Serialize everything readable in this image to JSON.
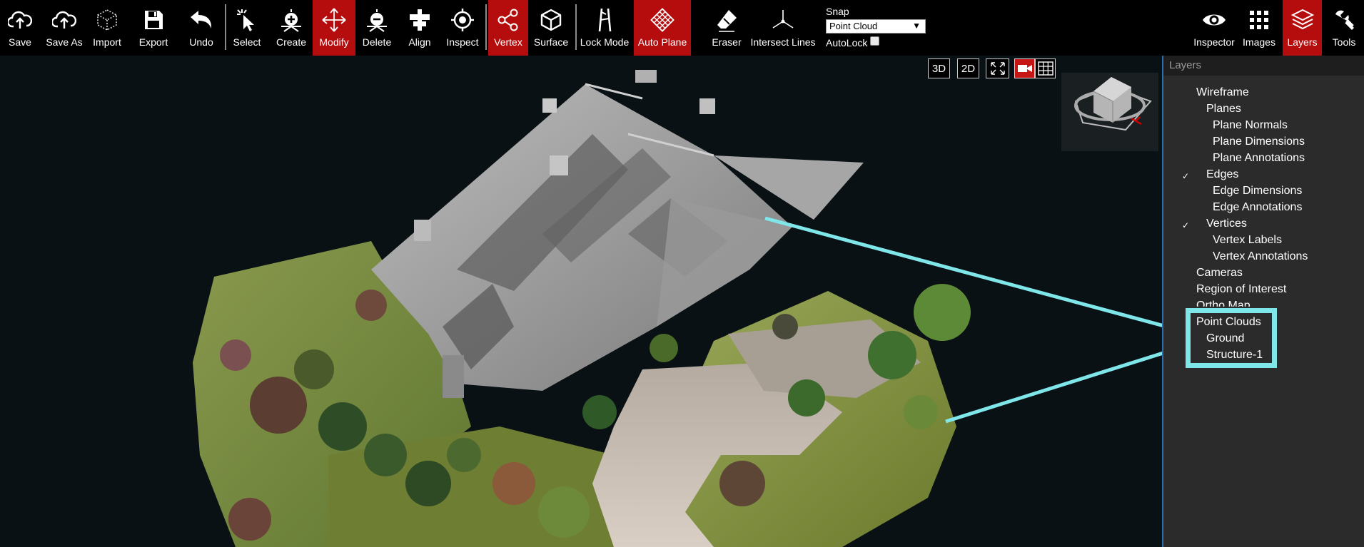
{
  "toolbar": {
    "tools": [
      {
        "id": "save",
        "label": "Save",
        "icon": "cloud-upload-icon"
      },
      {
        "id": "save-as",
        "label": "Save As",
        "icon": "cloud-upload-icon"
      },
      {
        "id": "import",
        "label": "Import",
        "icon": "cube-outline-icon"
      },
      {
        "id": "export",
        "label": "Export",
        "icon": "floppy-disk-icon"
      },
      {
        "id": "undo",
        "label": "Undo",
        "icon": "undo-arrow-icon"
      },
      {
        "id": "select",
        "label": "Select",
        "icon": "pointer-icon"
      },
      {
        "id": "create",
        "label": "Create",
        "icon": "plus-crosshair-icon"
      },
      {
        "id": "modify",
        "label": "Modify",
        "icon": "move-arrows-icon",
        "active": true
      },
      {
        "id": "delete",
        "label": "Delete",
        "icon": "minus-crosshair-icon"
      },
      {
        "id": "align",
        "label": "Align",
        "icon": "align-icon"
      },
      {
        "id": "inspect",
        "label": "Inspect",
        "icon": "target-icon"
      },
      {
        "id": "vertex",
        "label": "Vertex",
        "icon": "share-nodes-icon",
        "active": true
      },
      {
        "id": "surface",
        "label": "Surface",
        "icon": "cube-icon"
      },
      {
        "id": "lock-mode",
        "label": "Lock Mode",
        "icon": "lock-mode-icon"
      },
      {
        "id": "auto-plane",
        "label": "Auto Plane",
        "icon": "grid-diamond-icon",
        "active": true
      },
      {
        "id": "eraser",
        "label": "Eraser",
        "icon": "eraser-icon"
      },
      {
        "id": "intersect-lines",
        "label": "Intersect Lines",
        "icon": "axes-icon"
      },
      {
        "id": "inspector",
        "label": "Inspector",
        "icon": "eye-icon"
      },
      {
        "id": "images",
        "label": "Images",
        "icon": "grid-dots-icon"
      },
      {
        "id": "layers",
        "label": "Layers",
        "icon": "layers-icon",
        "active": true
      },
      {
        "id": "tools",
        "label": "Tools",
        "icon": "wrench-icon"
      }
    ],
    "snap_title": "Snap",
    "snap_value": "Point Cloud",
    "autolock_label": "AutoLock"
  },
  "view_controls": {
    "btn_3d": "3D",
    "btn_2d": "2D",
    "fullscreen_icon": "fullscreen-icon",
    "camera_icon": "video-camera-icon",
    "grid_icon": "grid-icon"
  },
  "layers_panel": {
    "title": "Layers",
    "items": [
      {
        "label": "Wireframe",
        "checked": false
      },
      {
        "label": "Planes",
        "checked": false
      },
      {
        "label": "Plane Normals",
        "checked": false
      },
      {
        "label": "Plane Dimensions",
        "checked": false
      },
      {
        "label": "Plane Annotations",
        "checked": false
      },
      {
        "label": "Edges",
        "checked": true
      },
      {
        "label": "Edge Dimensions",
        "checked": false
      },
      {
        "label": "Edge Annotations",
        "checked": false
      },
      {
        "label": "Vertices",
        "checked": true
      },
      {
        "label": "Vertex Labels",
        "checked": false
      },
      {
        "label": "Vertex Annotations",
        "checked": false
      },
      {
        "label": "Cameras",
        "checked": false
      },
      {
        "label": "Region of Interest",
        "checked": false
      },
      {
        "label": "Ortho Map",
        "checked": false
      },
      {
        "label": "Point Clouds",
        "checked": true
      },
      {
        "label": "Ground",
        "checked": true
      },
      {
        "label": "Structure-1",
        "checked": true
      }
    ]
  },
  "colors": {
    "accent_red": "#b50d0d",
    "highlight_cyan": "#7fe6ea",
    "panel_bg": "#2b2b2b",
    "viewport_bg": "#0a1114"
  }
}
